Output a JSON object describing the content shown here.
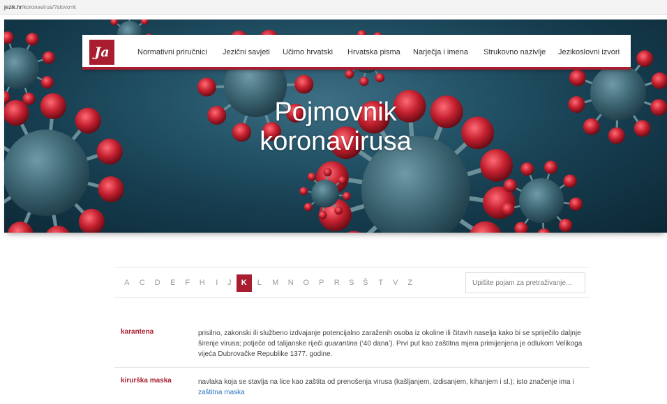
{
  "browser": {
    "url_host": "jezik.hr",
    "url_path": "/koronavirus/?slovo=k"
  },
  "nav": {
    "logo_text": "Ja",
    "items": [
      "Normativni priručnici",
      "Jezični savjeti",
      "Učimo hrvatski",
      "Hrvatska pisma",
      "Narječja i imena",
      "Strukovno nazivlje",
      "Jezikoslovni izvori"
    ]
  },
  "hero": {
    "title_line1": "Pojmovnik",
    "title_line2": "koronavirusa"
  },
  "alphabet": {
    "letters": [
      "A",
      "C",
      "D",
      "E",
      "F",
      "H",
      "I",
      "J",
      "K",
      "L",
      "M",
      "N",
      "O",
      "P",
      "R",
      "S",
      "Š",
      "T",
      "V",
      "Z"
    ],
    "active": "K"
  },
  "search": {
    "placeholder": "Upišite pojam za pretraživanje..."
  },
  "entries": [
    {
      "term": "karantena",
      "def_part1": "prisilno, zakonski ili službeno izdvajanje potencijalno zaraženih osoba iz okoline ili čitavih naselja kako bi se spriječilo daljnje širenje virusa; potječe od talijanske riječi ",
      "def_italic": "quarantina",
      "def_part2": " (‘40 dana’). Prvi put kao zaštitna mjera primijenjena je odlukom Velikoga vijeća Dubrovačke Republike 1377. godine."
    },
    {
      "term": "kirurška maska",
      "def_part1": "navlaka koja se stavlja na lice kao zaštita od prenošenja virusa (kašljanjem, izdisanjem, kihanjem i sl.); isto značenje ima i ",
      "def_link": "zaštitna maska"
    }
  ],
  "colors": {
    "brand": "#a81e30",
    "link": "#2a72c0"
  }
}
